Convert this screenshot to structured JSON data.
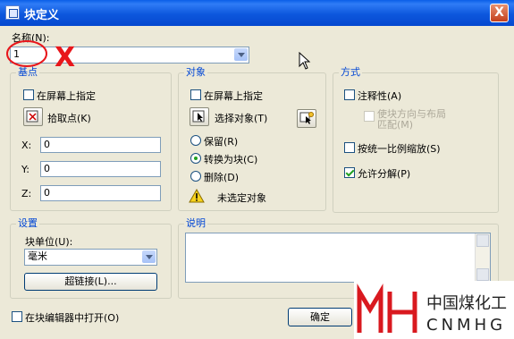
{
  "window": {
    "title": "块定义",
    "close": "X"
  },
  "name": {
    "label": "名称(N):",
    "value": "1"
  },
  "annotation": {
    "mark": "X"
  },
  "basepoint": {
    "group_label": "基点",
    "specify_on_screen": "在屏幕上指定",
    "pick_point": "拾取点(K)",
    "x_label": "X:",
    "x_value": "0",
    "y_label": "Y:",
    "y_value": "0",
    "z_label": "Z:",
    "z_value": "0"
  },
  "objects": {
    "group_label": "对象",
    "specify_on_screen": "在屏幕上指定",
    "select_objects": "选择对象(T)",
    "retain": "保留(R)",
    "convert_to_block": "转换为块(C)",
    "delete": "删除(D)",
    "warning": "未选定对象"
  },
  "behavior": {
    "group_label": "方式",
    "annotative": "注释性(A)",
    "match_orientation": "使块方向与布局",
    "match_orientation_2": "匹配(M)",
    "scale_uniformly": "按统一比例缩放(S)",
    "allow_exploding": "允许分解(P)"
  },
  "settings": {
    "group_label": "设置",
    "unit_label": "块单位(U):",
    "unit_value": "毫米",
    "hyperlink": "超链接(L)..."
  },
  "description": {
    "group_label": "说明"
  },
  "footer": {
    "open_in_editor": "在块编辑器中打开(O)",
    "ok": "确定"
  },
  "watermark": {
    "logo_text": "MH",
    "company_cn": "中国煤化工",
    "company_en": "CNMHG"
  },
  "colors": {
    "title_bar": "#0a5fe8",
    "group_label": "#0046d5",
    "annotation_red": "#e8161b",
    "watermark_red": "#d9191f"
  }
}
